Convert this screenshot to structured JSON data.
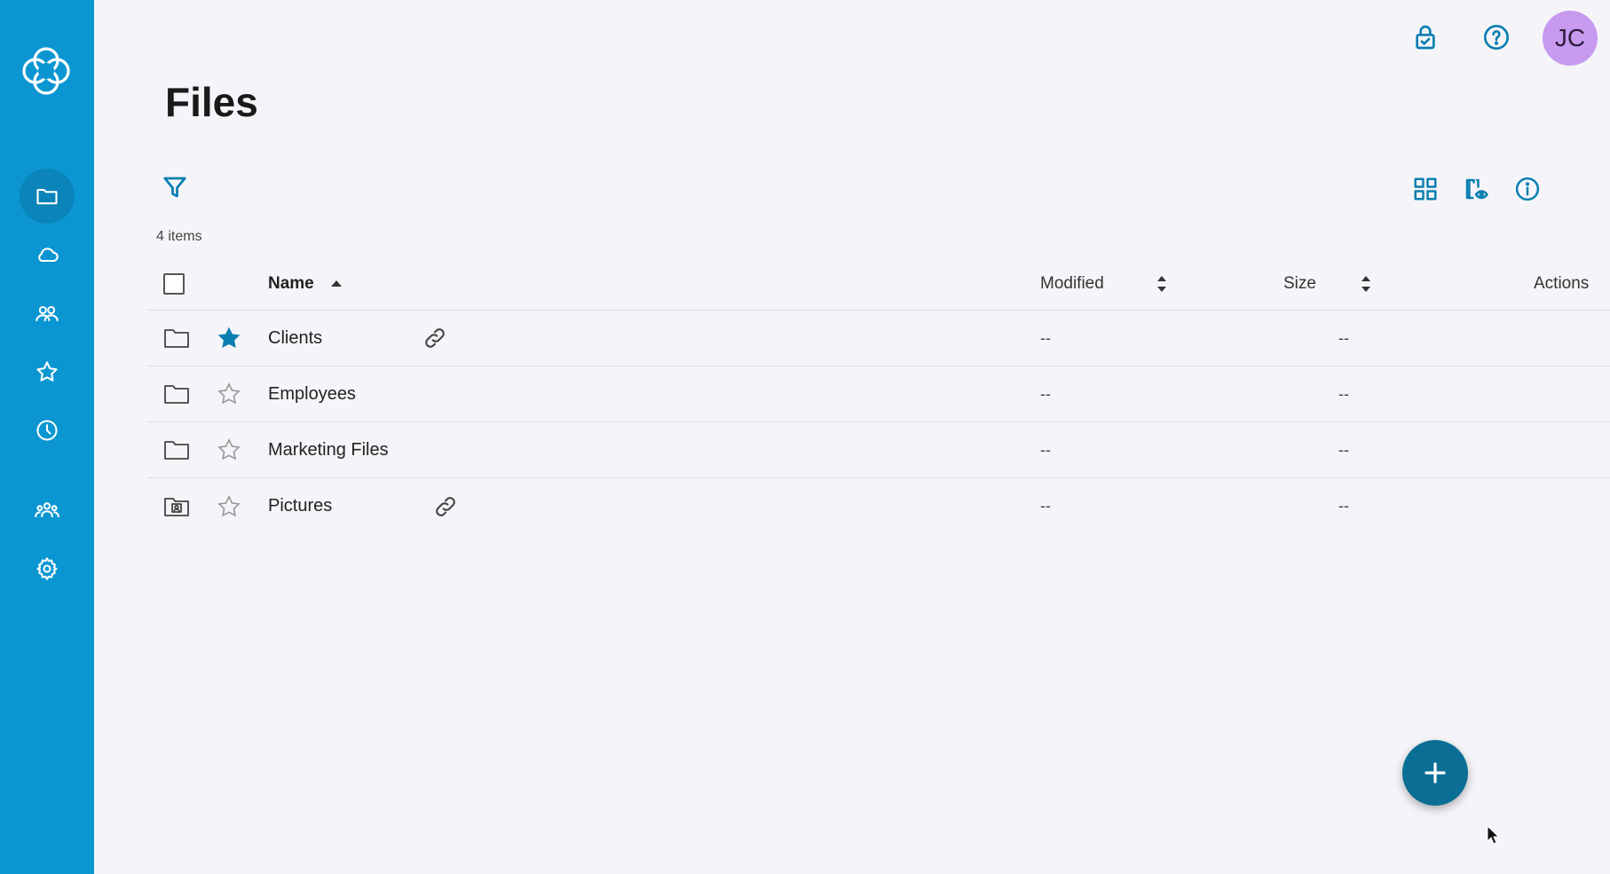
{
  "page": {
    "title": "Files",
    "item_count": "4 items"
  },
  "sidebar": {
    "items": [
      {
        "name": "files",
        "icon": "folder-icon",
        "active": true
      },
      {
        "name": "cloud",
        "icon": "cloud-icon",
        "active": false
      },
      {
        "name": "shared",
        "icon": "users-icon",
        "active": false
      },
      {
        "name": "favorites",
        "icon": "star-icon",
        "active": false
      },
      {
        "name": "recent",
        "icon": "clock-icon",
        "active": false
      },
      {
        "name": "groups",
        "icon": "group-icon",
        "active": false
      },
      {
        "name": "settings",
        "icon": "gear-icon",
        "active": false
      }
    ]
  },
  "header": {
    "avatar_initials": "JC"
  },
  "table": {
    "columns": {
      "name": "Name",
      "modified": "Modified",
      "size": "Size",
      "actions": "Actions"
    },
    "rows": [
      {
        "name": "Clients",
        "type": "folder",
        "favorite": true,
        "shared_link": true,
        "modified": "--",
        "size": "--"
      },
      {
        "name": "Employees",
        "type": "folder",
        "favorite": false,
        "shared_link": false,
        "modified": "--",
        "size": "--"
      },
      {
        "name": "Marketing Files",
        "type": "folder",
        "favorite": false,
        "shared_link": false,
        "modified": "--",
        "size": "--"
      },
      {
        "name": "Pictures",
        "type": "photo-folder",
        "favorite": false,
        "shared_link": true,
        "modified": "--",
        "size": "--"
      }
    ]
  },
  "colors": {
    "sidebar": "#0b96d2",
    "accent": "#0b7fb0",
    "fab": "#0b6f95",
    "avatar": "#c79af0"
  }
}
